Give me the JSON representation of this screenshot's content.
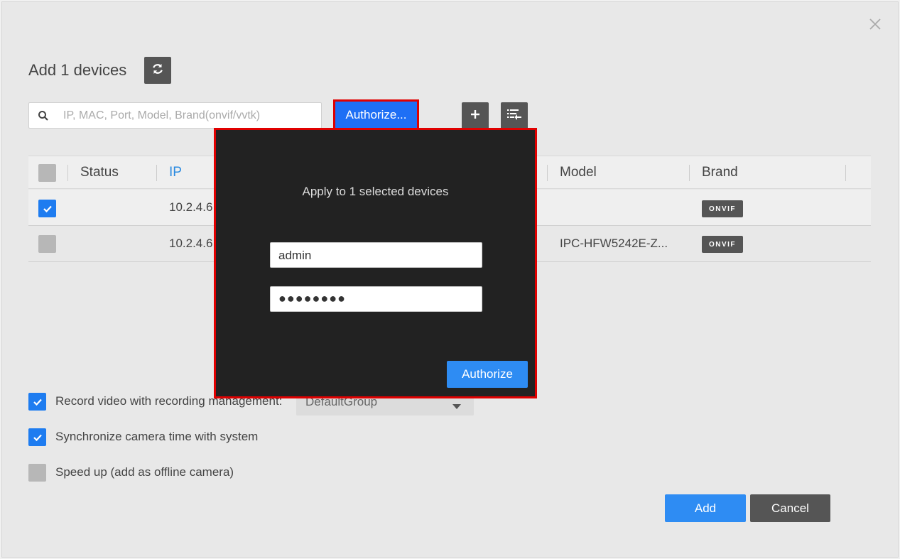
{
  "dialog": {
    "title": "Add 1 devices",
    "close_icon": "close-icon",
    "refresh_icon": "refresh-icon"
  },
  "toolbar": {
    "search_placeholder": "IP, MAC, Port, Model, Brand(onvif/vvtk)",
    "search_value": "",
    "authorize_label": "Authorize...",
    "add_icon": "plus-icon",
    "import_icon": "list-import-icon"
  },
  "table": {
    "columns": [
      "Status",
      "IP",
      "Model",
      "Brand"
    ],
    "rows": [
      {
        "selected": true,
        "status": "",
        "ip": "10.2.4.6",
        "model": "",
        "brand": "ONVIF"
      },
      {
        "selected": false,
        "status": "",
        "ip": "10.2.4.6",
        "model": "IPC-HFW5242E-Z...",
        "brand": "ONVIF"
      }
    ]
  },
  "options": {
    "record_label": "Record video with recording management:",
    "record_checked": true,
    "record_group": "DefaultGroup",
    "sync_label": "Synchronize camera time with system",
    "sync_checked": true,
    "speed_label": "Speed up (add as offline camera)",
    "speed_checked": false
  },
  "footer": {
    "add_label": "Add",
    "cancel_label": "Cancel"
  },
  "authorize_popup": {
    "message": "Apply to 1 selected devices",
    "username": "admin",
    "password_mask": "●●●●●●●●",
    "authorize_label": "Authorize"
  },
  "colors": {
    "accent": "#2e8cf3",
    "highlight": "#e00000",
    "popup_bg": "#222222"
  }
}
